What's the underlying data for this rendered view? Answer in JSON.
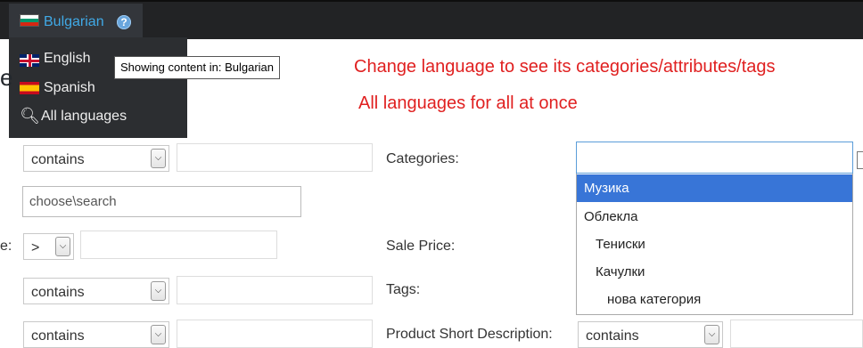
{
  "language_switcher": {
    "current": "Bulgarian",
    "help_glyph": "?",
    "options": [
      {
        "label": "English",
        "icon": "uk-flag-icon"
      },
      {
        "label": "Spanish",
        "icon": "spain-flag-icon"
      },
      {
        "label": "All languages",
        "icon": "globe-icon"
      }
    ],
    "tooltip": "Showing content in: Bulgarian"
  },
  "partial_heading": "e",
  "notes": {
    "line1": "Change language to see its categories/attributes/tags",
    "line2": "All languages for all at once"
  },
  "filters": {
    "row1_operator": "contains",
    "choose_search_placeholder": "choose\\search",
    "row3_label_fragment": "e:",
    "row3_operator": ">",
    "row4_operator": "contains",
    "row5_operator": "contains",
    "categories_label": "Categories:",
    "sale_price_label": "Sale Price:",
    "tags_label": "Tags:",
    "short_desc_label": "Product Short Description:",
    "short_desc_operator": "contains"
  },
  "categories_dropdown": {
    "search_value": "",
    "options": [
      {
        "label": "Музика",
        "selected": true
      },
      {
        "label": "Облекла",
        "selected": false
      },
      {
        "label": "Тениски",
        "selected": false
      },
      {
        "label": "Качулки",
        "selected": false
      },
      {
        "label": "нова категория",
        "selected": false
      }
    ]
  },
  "colors": {
    "topbar": "#222325",
    "accent_link": "#40a9e6",
    "note_red": "#e02020",
    "highlight": "#3875d7"
  }
}
